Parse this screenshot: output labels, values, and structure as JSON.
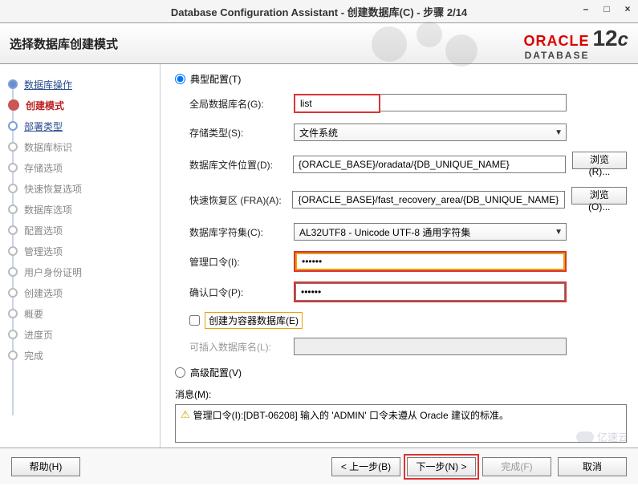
{
  "window": {
    "title": "Database Configuration Assistant - 创建数据库(C) - 步骤 2/14",
    "btn_min": "–",
    "btn_max": "□",
    "btn_close": "×"
  },
  "banner": {
    "title": "选择数据库创建模式",
    "oracle": "ORACLE",
    "database": "DATABASE",
    "version": "12",
    "suffix": "c"
  },
  "steps": {
    "s1": "数据库操作",
    "s2": "创建模式",
    "s3": "部署类型",
    "s4": "数据库标识",
    "s5": "存储选项",
    "s6": "快速恢复选项",
    "s7": "数据库选项",
    "s8": "配置选项",
    "s9": "管理选项",
    "s10": "用户身份证明",
    "s11": "创建选项",
    "s12": "概要",
    "s13": "进度页",
    "s14": "完成"
  },
  "form": {
    "radio_typical": "典型配置(T)",
    "radio_advanced": "高级配置(V)",
    "lbl_global": "全局数据库名(G):",
    "val_global": "list",
    "lbl_storage": "存储类型(S):",
    "val_storage": "文件系统",
    "lbl_dbfile": "数据库文件位置(D):",
    "val_dbfile": "{ORACLE_BASE}/oradata/{DB_UNIQUE_NAME}",
    "lbl_fra": "快速恢复区 (FRA)(A):",
    "val_fra": "{ORACLE_BASE}/fast_recovery_area/{DB_UNIQUE_NAME}",
    "lbl_charset": "数据库字符集(C):",
    "val_charset": "AL32UTF8 - Unicode UTF-8 通用字符集",
    "lbl_admin": "管理口令(I):",
    "val_admin": "••••••",
    "lbl_confirm": "确认口令(P):",
    "val_confirm": "••••••",
    "chk_container": "创建为容器数据库(E)",
    "lbl_pluggable": "可插入数据库名(L):",
    "browse_r": "浏览(R)...",
    "browse_o": "浏览(O)...",
    "msg_label": "消息(M):",
    "msg_text": "管理口令(I):[DBT-06208] 输入的 'ADMIN' 口令未遵从 Oracle 建议的标准。"
  },
  "footer": {
    "help": "帮助(H)",
    "back": "< 上一步(B)",
    "next": "下一步(N) >",
    "finish": "完成(F)",
    "cancel": "取消"
  },
  "watermark": "亿速云"
}
